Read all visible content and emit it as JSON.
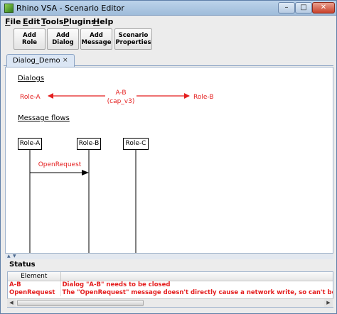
{
  "window": {
    "title": "Rhino VSA - Scenario Editor"
  },
  "menu": [
    "File",
    "Edit",
    "Tools",
    "Plugins",
    "Help"
  ],
  "toolbar": {
    "add_role": "Add\nRole",
    "add_dialog": "Add\nDialog",
    "add_message": "Add\nMessage",
    "scenario_properties": "Scenario\nProperties"
  },
  "tab": {
    "label": "Dialog_Demo",
    "close": "×"
  },
  "canvas": {
    "dialogs_heading": "Dialogs",
    "dialog": {
      "from": "Role-A",
      "name": "A-B",
      "cap": "(cap_v3)",
      "to": "Role-B"
    },
    "message_flows_heading": "Message flows",
    "roles": [
      "Role-A",
      "Role-B",
      "Role-C"
    ],
    "message": "OpenRequest"
  },
  "status": {
    "title": "Status",
    "columns": [
      "Element",
      ""
    ],
    "rows": [
      {
        "element": "A-B",
        "message": "Dialog \"A-B\" needs to be closed"
      },
      {
        "element": "OpenRequest",
        "message": "The \"OpenRequest\" message doesn't directly cause a network write, so can't be last mess"
      }
    ]
  },
  "colors": {
    "error": "#e41e1e",
    "titlebar": "#b7cde6"
  },
  "icons": [
    "app-icon",
    "minimize-icon",
    "maximize-icon",
    "close-icon",
    "tab-close-icon",
    "splitter-up-icon",
    "splitter-down-icon",
    "scroll-left-icon",
    "scroll-right-icon"
  ]
}
